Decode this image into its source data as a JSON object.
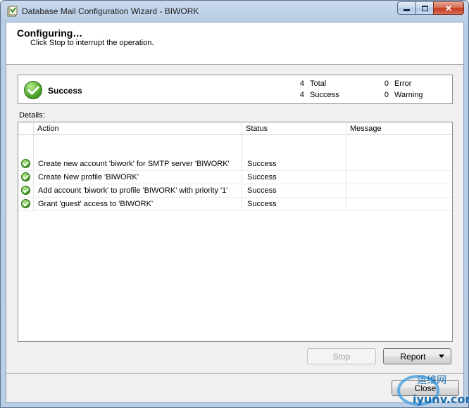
{
  "window": {
    "title": "Database Mail Configuration Wizard - BIWORK",
    "icons": {
      "app": "wizard-app-icon",
      "minimize": "minimize-icon",
      "maximize": "maximize-icon",
      "close": "close-icon"
    }
  },
  "header": {
    "title": "Configuring…",
    "subtitle": "Click Stop to interrupt the operation."
  },
  "summary": {
    "status": "Success",
    "total_count": "4",
    "total_label": "Total",
    "success_count": "4",
    "success_label": "Success",
    "error_count": "0",
    "error_label": "Error",
    "warning_count": "0",
    "warning_label": "Warning"
  },
  "details": {
    "label": "Details:",
    "columns": [
      "Action",
      "Status",
      "Message"
    ],
    "rows": [
      {
        "action": "Create new account 'biwork' for SMTP server 'BIWORK'",
        "status": "Success",
        "message": ""
      },
      {
        "action": "Create New profile 'BIWORK'",
        "status": "Success",
        "message": ""
      },
      {
        "action": "Add account 'biwork' to profile 'BIWORK' with priority '1'",
        "status": "Success",
        "message": ""
      },
      {
        "action": "Grant 'guest' access to 'BIWORK'",
        "status": "Success",
        "message": ""
      }
    ]
  },
  "buttons": {
    "stop": "Stop",
    "report": "Report",
    "close": "Close"
  },
  "watermark": {
    "line1": "运维网",
    "line2": "iyunv.com"
  },
  "colors": {
    "success_green": "#4fa62c",
    "title_bar": "#c9d9ec"
  }
}
